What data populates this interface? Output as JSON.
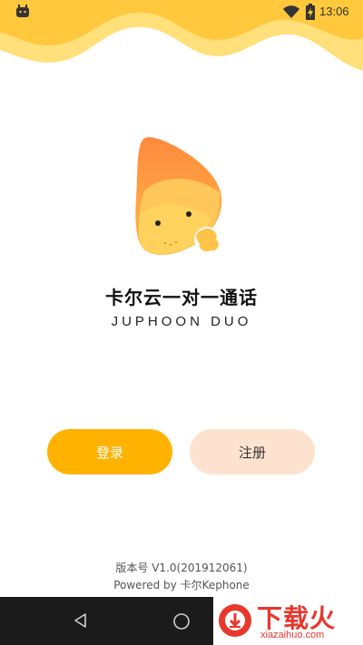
{
  "status_bar": {
    "time": "13:06",
    "left_icon": "app-notification-icon",
    "wifi_icon": "wifi-icon",
    "battery_icon": "battery-charging-icon"
  },
  "app": {
    "name": "卡尔云一对一通话",
    "subtitle": "JUPHOON DUO",
    "logo": "juphoon-logo"
  },
  "buttons": {
    "login_label": "登录",
    "register_label": "注册"
  },
  "footer": {
    "version": "版本号 V1.0(201912061)",
    "powered_by": "Powered by 卡尔Kephone"
  },
  "nav_bar": {
    "back_icon": "back-icon",
    "home_icon": "home-icon"
  },
  "watermark": {
    "text": "下载火",
    "url": "xiazaihuo.com"
  },
  "colors": {
    "primary": "#ffb300",
    "secondary": "#fde2cf",
    "nav": "#1b1b1b",
    "watermark": "#e8382e"
  }
}
